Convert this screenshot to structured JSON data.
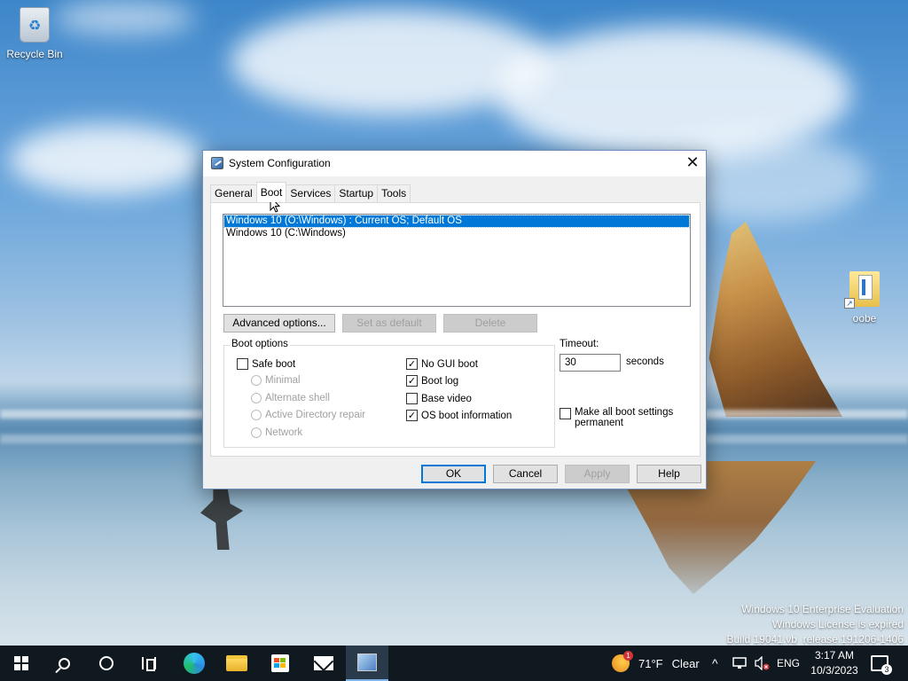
{
  "desktop": {
    "icons": [
      {
        "label": "Recycle Bin",
        "icon": "recycle-bin-icon"
      },
      {
        "label": "oobe",
        "icon": "folder-shortcut-icon"
      }
    ],
    "watermark": {
      "line1": "Windows 10 Enterprise Evaluation",
      "line2": "Windows License is expired",
      "line3": "Build 19041.vb_release.191206-1406"
    }
  },
  "dialog": {
    "title": "System Configuration",
    "close_glyph": "✕",
    "tabs": [
      "General",
      "Boot",
      "Services",
      "Startup",
      "Tools"
    ],
    "active_tab": "Boot",
    "os_list": [
      {
        "label": "Windows 10 (O:\\Windows) : Current OS; Default OS",
        "selected": true
      },
      {
        "label": "Windows 10 (C:\\Windows)",
        "selected": false
      }
    ],
    "buttons": {
      "advanced": "Advanced options...",
      "set_default": "Set as default",
      "delete": "Delete"
    },
    "boot_options": {
      "title": "Boot options",
      "safe_boot": {
        "label": "Safe boot",
        "checked": false
      },
      "radios": [
        "Minimal",
        "Alternate shell",
        "Active Directory repair",
        "Network"
      ],
      "no_gui_boot": {
        "label": "No GUI boot",
        "checked": true
      },
      "boot_log": {
        "label": "Boot log",
        "checked": true
      },
      "base_video": {
        "label": "Base video",
        "checked": false
      },
      "os_boot_info": {
        "label": "OS boot information",
        "checked": true
      }
    },
    "timeout": {
      "label": "Timeout:",
      "value": "30",
      "unit": "seconds"
    },
    "permanent": {
      "label": "Make all boot settings permanent",
      "checked": false
    },
    "footer": {
      "ok": "OK",
      "cancel": "Cancel",
      "apply": "Apply",
      "help": "Help"
    },
    "check_glyph": "✓"
  },
  "taskbar": {
    "items": [
      {
        "name": "start",
        "icon": "windows-logo-icon"
      },
      {
        "name": "search",
        "icon": "search-icon"
      },
      {
        "name": "cortana",
        "icon": "cortana-circle-icon"
      },
      {
        "name": "task-view",
        "icon": "task-view-icon"
      },
      {
        "name": "edge",
        "icon": "edge-browser-icon"
      },
      {
        "name": "file-explorer",
        "icon": "folder-icon"
      },
      {
        "name": "store",
        "icon": "store-icon"
      },
      {
        "name": "mail",
        "icon": "mail-icon"
      },
      {
        "name": "msconfig",
        "icon": "system-configuration-icon",
        "active": true
      }
    ],
    "weather": {
      "badge": "1",
      "temperature": "71°F",
      "condition": "Clear"
    },
    "tray": {
      "chevron": "^",
      "language": "ENG"
    },
    "clock": {
      "time": "3:17 AM",
      "date": "10/3/2023"
    },
    "notifications": {
      "count": "3"
    }
  }
}
